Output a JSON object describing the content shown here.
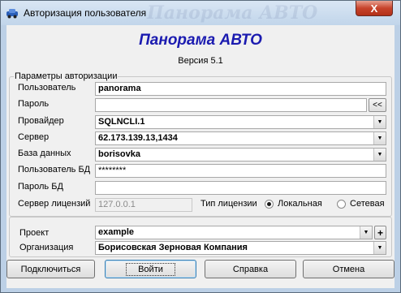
{
  "window": {
    "title": "Авторизация пользователя",
    "ghost_title": "Панорама АВТО",
    "close_symbol": "X",
    "accent_color": "#1b1bb0"
  },
  "header": {
    "app_name": "Панорама АВТО",
    "version": "Версия 5.1"
  },
  "auth_group": {
    "legend": "Параметры авторизации",
    "user_label": "Пользователь",
    "user_value": "panorama",
    "password_label": "Пароль",
    "password_value": "",
    "password_btn": "<<",
    "provider_label": "Провайдер",
    "provider_value": "SQLNCLI.1",
    "server_label": "Сервер",
    "server_value": "62.173.139.13,1434",
    "database_label": "База данных",
    "database_value": "borisovka",
    "db_user_label": "Пользователь БД",
    "db_user_value": "********",
    "db_password_label": "Пароль БД",
    "db_password_value": "",
    "license_server_label": "Сервер лицензий",
    "license_server_value": "127.0.0.1",
    "license_type_label": "Тип лицензии",
    "license_local": "Локальная",
    "license_network": "Сетевая",
    "license_selected": "Локальная"
  },
  "project_group": {
    "project_label": "Проект",
    "project_value": "example",
    "add_btn": "+",
    "org_label": "Организация",
    "org_value": "Борисовская Зерновая Компания"
  },
  "buttons": {
    "connect": "Подключиться",
    "login": "Войти",
    "help": "Справка",
    "cancel": "Отмена"
  }
}
